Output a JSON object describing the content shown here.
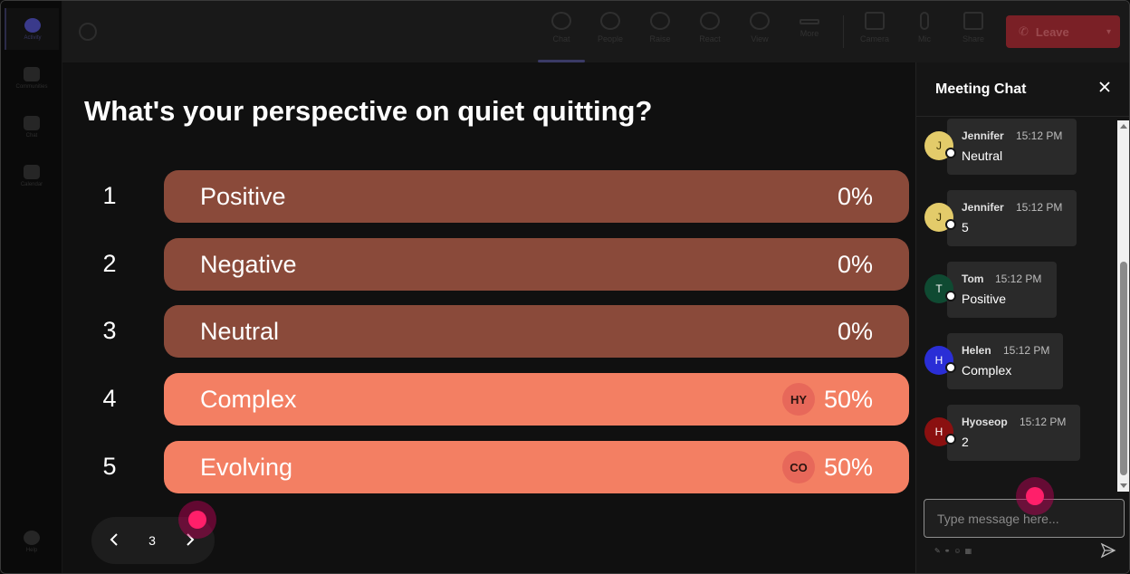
{
  "rail": {
    "items": [
      {
        "label": "Activity",
        "icon": "bell-icon",
        "active": true
      },
      {
        "label": "Communities",
        "icon": "communities-icon"
      },
      {
        "label": "Chat",
        "icon": "chat-icon"
      },
      {
        "label": "Calendar",
        "icon": "calendar-icon"
      }
    ],
    "help_label": "Help"
  },
  "toolbar": {
    "items": [
      {
        "label": "Chat",
        "icon": "chat-icon"
      },
      {
        "label": "People",
        "icon": "people-icon"
      },
      {
        "label": "Raise",
        "icon": "raise-hand-icon"
      },
      {
        "label": "React",
        "icon": "react-icon"
      },
      {
        "label": "View",
        "icon": "view-icon"
      },
      {
        "label": "More",
        "icon": "more-icon"
      },
      {
        "label": "Camera",
        "icon": "camera-icon"
      },
      {
        "label": "Mic",
        "icon": "mic-icon"
      },
      {
        "label": "Share",
        "icon": "share-icon"
      }
    ],
    "leave_label": "Leave"
  },
  "poll": {
    "title": "What's your perspective on quiet quitting?",
    "options": [
      {
        "num": "1",
        "label": "Positive",
        "percent": "0%",
        "value": 0,
        "voter": ""
      },
      {
        "num": "2",
        "label": "Negative",
        "percent": "0%",
        "value": 0,
        "voter": ""
      },
      {
        "num": "3",
        "label": "Neutral",
        "percent": "0%",
        "value": 0,
        "voter": ""
      },
      {
        "num": "4",
        "label": "Complex",
        "percent": "50%",
        "value": 50,
        "voter": "HY"
      },
      {
        "num": "5",
        "label": "Evolving",
        "percent": "50%",
        "value": 50,
        "voter": "CO"
      }
    ],
    "colors": {
      "zero": "#8a4a3a",
      "voted": "#f37f63"
    }
  },
  "pager": {
    "page": "3"
  },
  "chat": {
    "title": "Meeting Chat",
    "messages": [
      {
        "initial": "J",
        "name": "Jennifer",
        "time": "15:12 PM",
        "text": "Neutral",
        "avatar_color": "#e3cb6a",
        "initial_color": "#3a3000"
      },
      {
        "initial": "J",
        "name": "Jennifer",
        "time": "15:12 PM",
        "text": "5",
        "avatar_color": "#e3cb6a",
        "initial_color": "#3a3000"
      },
      {
        "initial": "T",
        "name": "Tom",
        "time": "15:12 PM",
        "text": "Positive",
        "avatar_color": "#0f4a32",
        "initial_color": "#ffffff"
      },
      {
        "initial": "H",
        "name": "Helen",
        "time": "15:12 PM",
        "text": "Complex",
        "avatar_color": "#2a2ed6",
        "initial_color": "#ffffff"
      },
      {
        "initial": "H",
        "name": "Hyoseop",
        "time": "15:12 PM",
        "text": "2",
        "avatar_color": "#8a1010",
        "initial_color": "#ffffff"
      }
    ],
    "compose_placeholder": "Type message here...",
    "format_icons": [
      "format-icon",
      "attach-icon",
      "emoji-icon",
      "gif-icon"
    ]
  }
}
